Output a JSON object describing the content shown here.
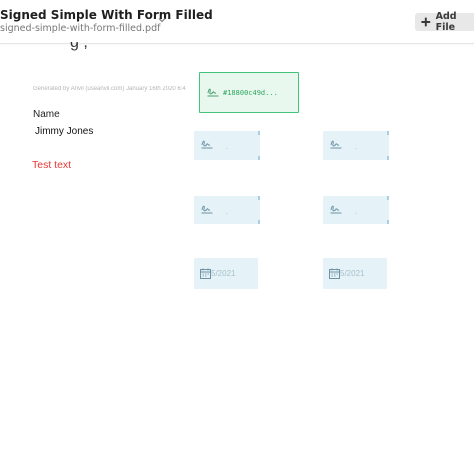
{
  "header": {
    "title": "Signed Simple With Form Filled",
    "subtitle": "signed-simple-with-form-filled.pdf",
    "add_file_label": "Add File"
  },
  "document": {
    "heading_fragment": "g    ,",
    "generated_text": "Generated by Anvil (useanvil.com) January 16th 2020 6:4",
    "name_label": "Name",
    "name_value": "Jimmy Jones",
    "test_text": "Test text"
  },
  "fields": {
    "active_signature_hash": "#18800c49d...",
    "signature_placeholder": ".",
    "date_fragment": "5/2021"
  },
  "colors": {
    "field_bg": "#e5f3f8",
    "active_field_border": "#42c27a",
    "active_field_text": "#2fa55f",
    "test_text": "#e53935",
    "add_file_bg": "#e8e8e8"
  },
  "icons": {
    "chevron": "chevron-down-icon",
    "add": "plus-icon",
    "signature": "signature-icon",
    "calendar": "calendar-icon"
  }
}
